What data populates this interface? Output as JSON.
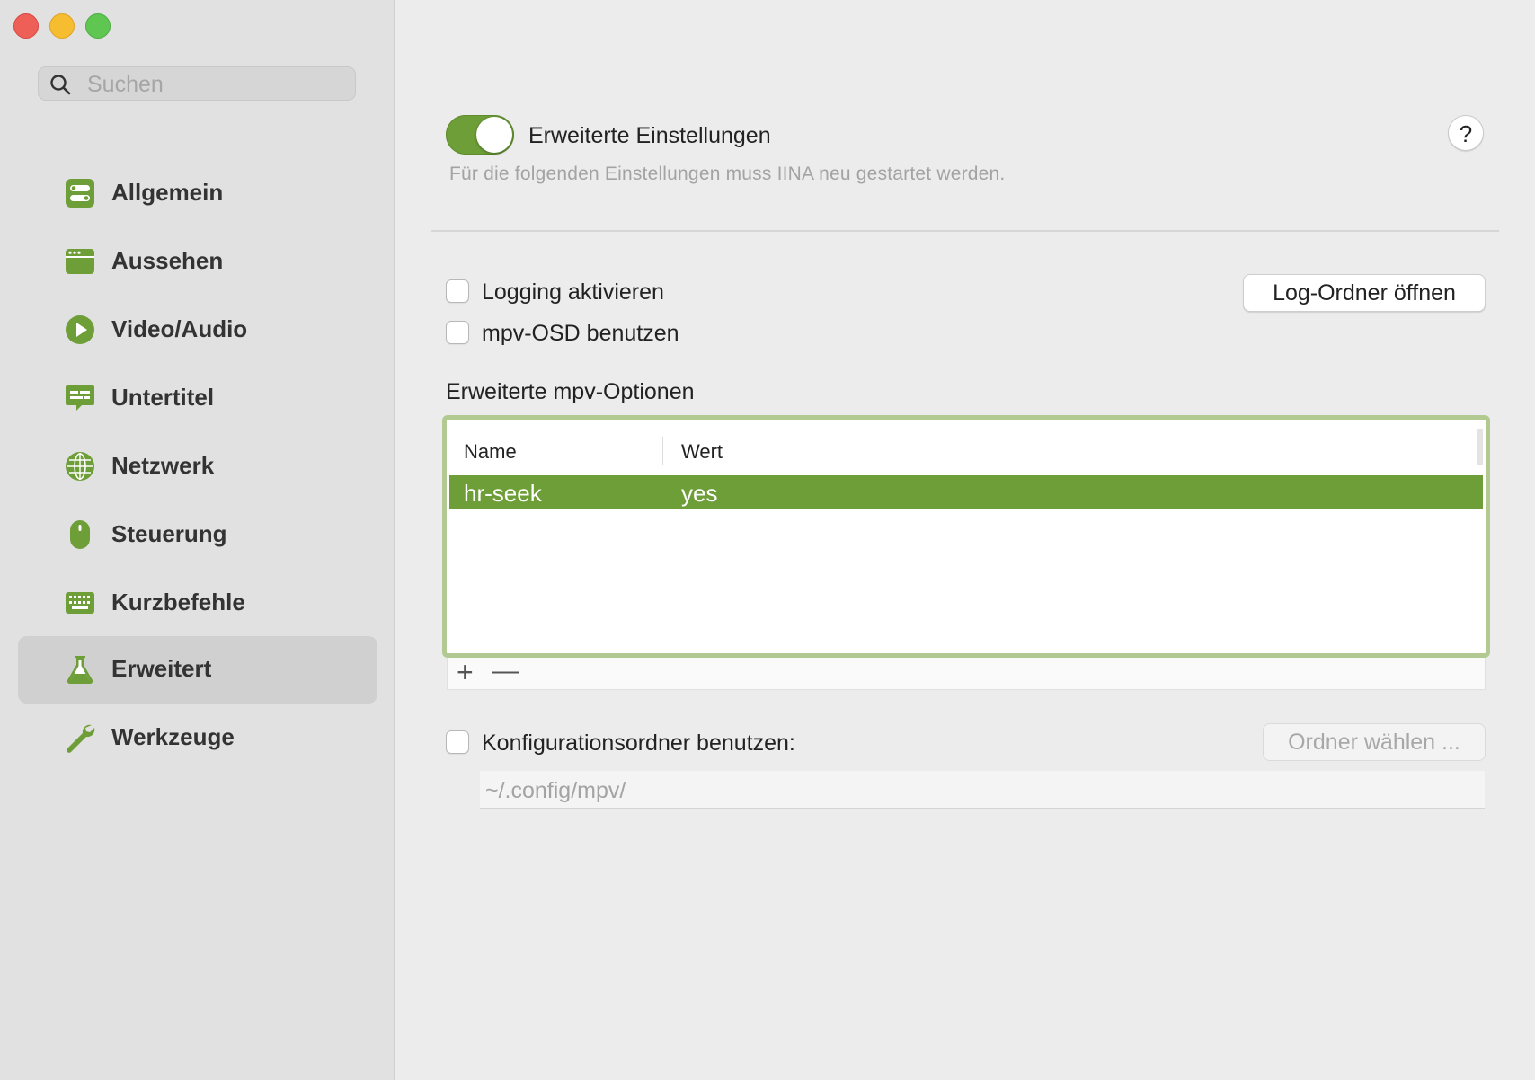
{
  "colors": {
    "accent": "#6e9e38",
    "table_focus_ring": "#b2ca91",
    "sidebar_bg": "#e1e1e1",
    "content_bg": "#ececec"
  },
  "search": {
    "placeholder": "Suchen",
    "icon": "search-icon"
  },
  "sidebar": {
    "items": [
      {
        "label": "Allgemein",
        "icon": "general-icon"
      },
      {
        "label": "Aussehen",
        "icon": "window-icon"
      },
      {
        "label": "Video/Audio",
        "icon": "play-icon"
      },
      {
        "label": "Untertitel",
        "icon": "subtitle-icon"
      },
      {
        "label": "Netzwerk",
        "icon": "globe-icon"
      },
      {
        "label": "Steuerung",
        "icon": "mouse-icon"
      },
      {
        "label": "Kurzbefehle",
        "icon": "keyboard-icon"
      },
      {
        "label": "Erweitert",
        "icon": "flask-icon",
        "active": true
      },
      {
        "label": "Werkzeuge",
        "icon": "wrench-icon"
      }
    ]
  },
  "advanced": {
    "toggle_on": true,
    "title": "Erweiterte Einstellungen",
    "subtitle": "Für die folgenden Einstellungen muss IINA neu gestartet werden.",
    "help_label": "?"
  },
  "logging": {
    "enable_label": "Logging aktivieren",
    "enable_checked": false,
    "open_folder_label": "Log-Ordner öffnen",
    "osd_label": "mpv-OSD benutzen",
    "osd_checked": false
  },
  "mpv_options": {
    "title": "Erweiterte mpv-Optionen",
    "columns": [
      "Name",
      "Wert"
    ],
    "rows": [
      {
        "name": "hr-seek",
        "value": "yes",
        "selected": true
      }
    ],
    "add_label": "+",
    "remove_label": "—"
  },
  "config_dir": {
    "label": "Konfigurationsordner benutzen:",
    "checked": false,
    "choose_label": "Ordner wählen ...",
    "path_placeholder": "~/.config/mpv/"
  }
}
